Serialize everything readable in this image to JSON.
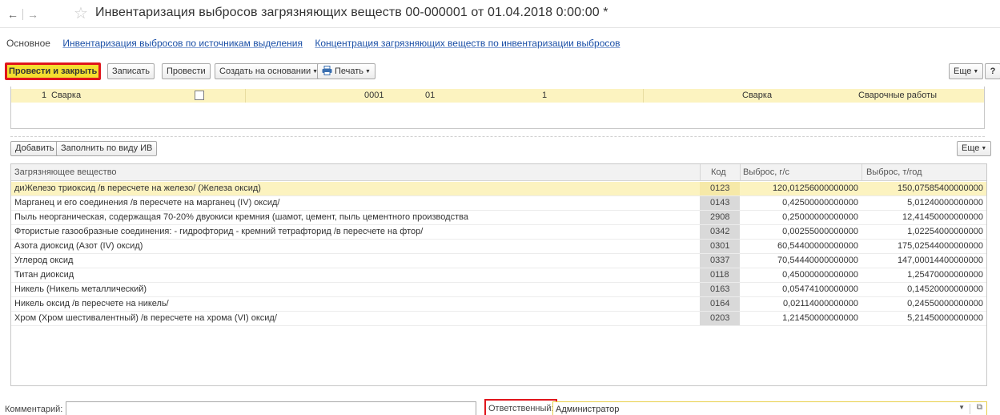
{
  "window": {
    "title": "Инвентаризация выбросов загрязняющих веществ 00-000001 от 01.04.2018 0:00:00 *",
    "back_glyph": "←",
    "forward_glyph": "→",
    "favorite_glyph": "☆"
  },
  "tabs": [
    {
      "label": "Основное"
    },
    {
      "label": "Инвентаризация выбросов по источникам выделения"
    },
    {
      "label": "Концентрация загрязняющих веществ по инвентаризации выбросов"
    }
  ],
  "toolbar": {
    "post_close": "Провести и закрыть",
    "write": "Записать",
    "post": "Провести",
    "create_based": "Создать на основании",
    "print": "Печать",
    "more": "Еще",
    "help": "?"
  },
  "sources": {
    "row": {
      "num": "1",
      "name": "Сварка",
      "code1": "0001",
      "code2": "01",
      "count": "1",
      "kind": "Сварка",
      "work": "Сварочные работы"
    }
  },
  "toolbar2": {
    "add": "Добавить",
    "fill": "Заполнить по виду ИВ",
    "more": "Еще"
  },
  "grid": {
    "headers": {
      "name": "Загрязняющее вещество",
      "code": "Код",
      "gs": "Выброс, г/с",
      "ty": "Выброс, т/год"
    },
    "rows": [
      {
        "name": "диЖелезо триоксид /в пересчете на железо/ (Железа оксид)",
        "code": "0123",
        "gs": "120,01256000000000",
        "ty": "150,07585400000000",
        "selected": true
      },
      {
        "name": "Марганец и его соединения /в пересчете на марганец (IV) оксид/",
        "code": "0143",
        "gs": "0,42500000000000",
        "ty": "5,01240000000000"
      },
      {
        "name": "Пыль неорганическая, содержащая 70-20% двуокиси кремния (шамот, цемент, пыль цементного производства",
        "code": "2908",
        "gs": "0,25000000000000",
        "ty": "12,41450000000000"
      },
      {
        "name": "Фтористые газообразные соединения: - гидрофторид - кремний тетрафторид /в пересчете на фтор/",
        "code": "0342",
        "gs": "0,00255000000000",
        "ty": "1,02254000000000"
      },
      {
        "name": "Азота диоксид (Азот (IV) оксид)",
        "code": "0301",
        "gs": "60,54400000000000",
        "ty": "175,02544000000000"
      },
      {
        "name": "Углерод оксид",
        "code": "0337",
        "gs": "70,54440000000000",
        "ty": "147,00014400000000"
      },
      {
        "name": "Титан диоксид",
        "code": "0118",
        "gs": "0,45000000000000",
        "ty": "1,25470000000000"
      },
      {
        "name": "Никель (Никель металлический)",
        "code": "0163",
        "gs": "0,05474100000000",
        "ty": "0,14520000000000"
      },
      {
        "name": "Никель оксид /в пересчете на никель/",
        "code": "0164",
        "gs": "0,02114000000000",
        "ty": "0,24550000000000"
      },
      {
        "name": "Хром (Хром шестивалентный) /в пересчете на хрома (VI) оксид/",
        "code": "0203",
        "gs": "1,21450000000000",
        "ty": "5,21450000000000"
      }
    ]
  },
  "bottom": {
    "comment_label": "Комментарий:",
    "comment_value": "",
    "responsible_label": "Ответственный:",
    "responsible_value": "Администратор"
  },
  "colors": {
    "accent_yellow": "#f4df2f",
    "highlight_red": "#e0151c",
    "selected_row": "#fcf3c0",
    "link": "#1a4fa6"
  }
}
